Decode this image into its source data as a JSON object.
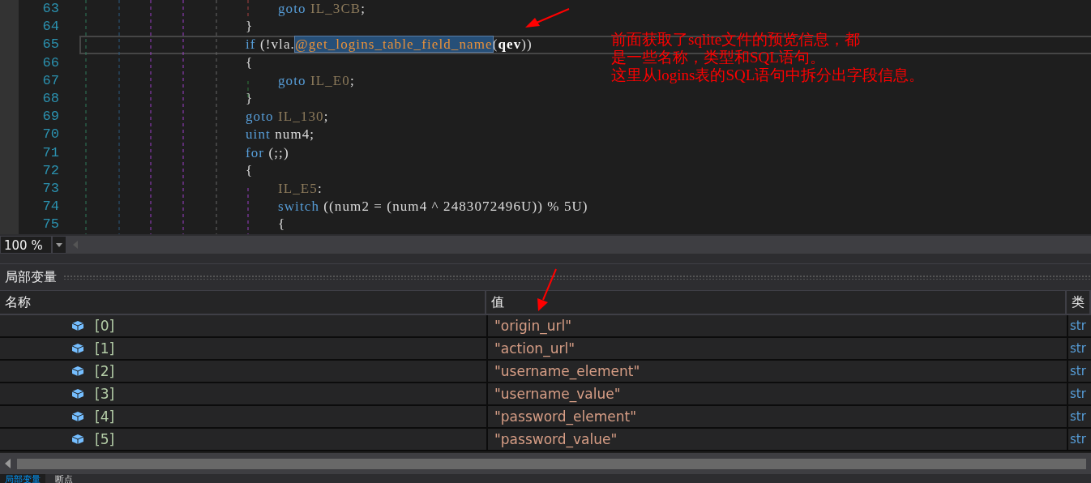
{
  "editor": {
    "lines": [
      {
        "number": "63",
        "current": false,
        "indented": true,
        "tokens": [
          {
            "text": "goto",
            "kind": "keyword"
          },
          {
            "text": " IL_3CB",
            "kind": "label"
          },
          {
            "text": ";",
            "kind": "plain"
          }
        ]
      },
      {
        "number": "64",
        "current": false,
        "indented": false,
        "tokens": [
          {
            "text": "}",
            "kind": "plain"
          }
        ]
      },
      {
        "number": "65",
        "current": true,
        "indented": false,
        "tokens": [
          {
            "text": "if",
            "kind": "keyword"
          },
          {
            "text": " (!vla.",
            "kind": "plain"
          },
          {
            "text": "@get_logins_table_field_name",
            "kind": "method",
            "selected": true
          },
          {
            "text": "(",
            "kind": "plain"
          },
          {
            "text": "qev",
            "kind": "param"
          },
          {
            "text": "))",
            "kind": "plain"
          }
        ]
      },
      {
        "number": "66",
        "current": false,
        "indented": false,
        "tokens": [
          {
            "text": "{",
            "kind": "plain"
          }
        ]
      },
      {
        "number": "67",
        "current": false,
        "indented": true,
        "tokens": [
          {
            "text": "goto",
            "kind": "keyword"
          },
          {
            "text": " IL_E0",
            "kind": "label"
          },
          {
            "text": ";",
            "kind": "plain"
          }
        ]
      },
      {
        "number": "68",
        "current": false,
        "indented": false,
        "tokens": [
          {
            "text": "}",
            "kind": "plain"
          }
        ]
      },
      {
        "number": "69",
        "current": false,
        "indented": false,
        "tokens": [
          {
            "text": "goto",
            "kind": "keyword"
          },
          {
            "text": " IL_130",
            "kind": "label"
          },
          {
            "text": ";",
            "kind": "plain"
          }
        ]
      },
      {
        "number": "70",
        "current": false,
        "indented": false,
        "tokens": [
          {
            "text": "uint",
            "kind": "keyword"
          },
          {
            "text": " num4;",
            "kind": "plain"
          }
        ]
      },
      {
        "number": "71",
        "current": false,
        "indented": false,
        "tokens": [
          {
            "text": "for",
            "kind": "keyword"
          },
          {
            "text": " (;;)",
            "kind": "plain"
          }
        ]
      },
      {
        "number": "72",
        "current": false,
        "indented": false,
        "tokens": [
          {
            "text": "{",
            "kind": "plain"
          }
        ]
      },
      {
        "number": "73",
        "current": false,
        "indented": true,
        "tokens": [
          {
            "text": "IL_E5",
            "kind": "label"
          },
          {
            "text": ":",
            "kind": "plain"
          }
        ]
      },
      {
        "number": "74",
        "current": false,
        "indented": true,
        "tokens": [
          {
            "text": "switch",
            "kind": "keyword"
          },
          {
            "text": " ((num2 = (num4 ^ 2483072496U)) % 5U)",
            "kind": "plain"
          }
        ]
      },
      {
        "number": "75",
        "current": false,
        "indented": true,
        "tokens": [
          {
            "text": "{",
            "kind": "plain"
          }
        ]
      }
    ]
  },
  "annotation": {
    "lines": [
      "前面获取了sqlite文件的预览信息，都",
      "是一些名称，类型和SQL语句。",
      "这里从logins表的SQL语句中拆分出字段信息。"
    ]
  },
  "zoom": {
    "value": "100 %"
  },
  "locals_panel": {
    "title": "局部变量",
    "columns": [
      "名称",
      "值",
      "类"
    ],
    "rows": [
      {
        "name": "[0]",
        "value": "\"origin_url\"",
        "type": "str"
      },
      {
        "name": "[1]",
        "value": "\"action_url\"",
        "type": "str"
      },
      {
        "name": "[2]",
        "value": "\"username_element\"",
        "type": "str"
      },
      {
        "name": "[3]",
        "value": "\"username_value\"",
        "type": "str"
      },
      {
        "name": "[4]",
        "value": "\"password_element\"",
        "type": "str"
      },
      {
        "name": "[5]",
        "value": "\"password_value\"",
        "type": "str"
      }
    ]
  },
  "bottom_tabs": [
    {
      "label": "局部变量",
      "selected": true
    },
    {
      "label": "断点",
      "selected": false
    }
  ]
}
